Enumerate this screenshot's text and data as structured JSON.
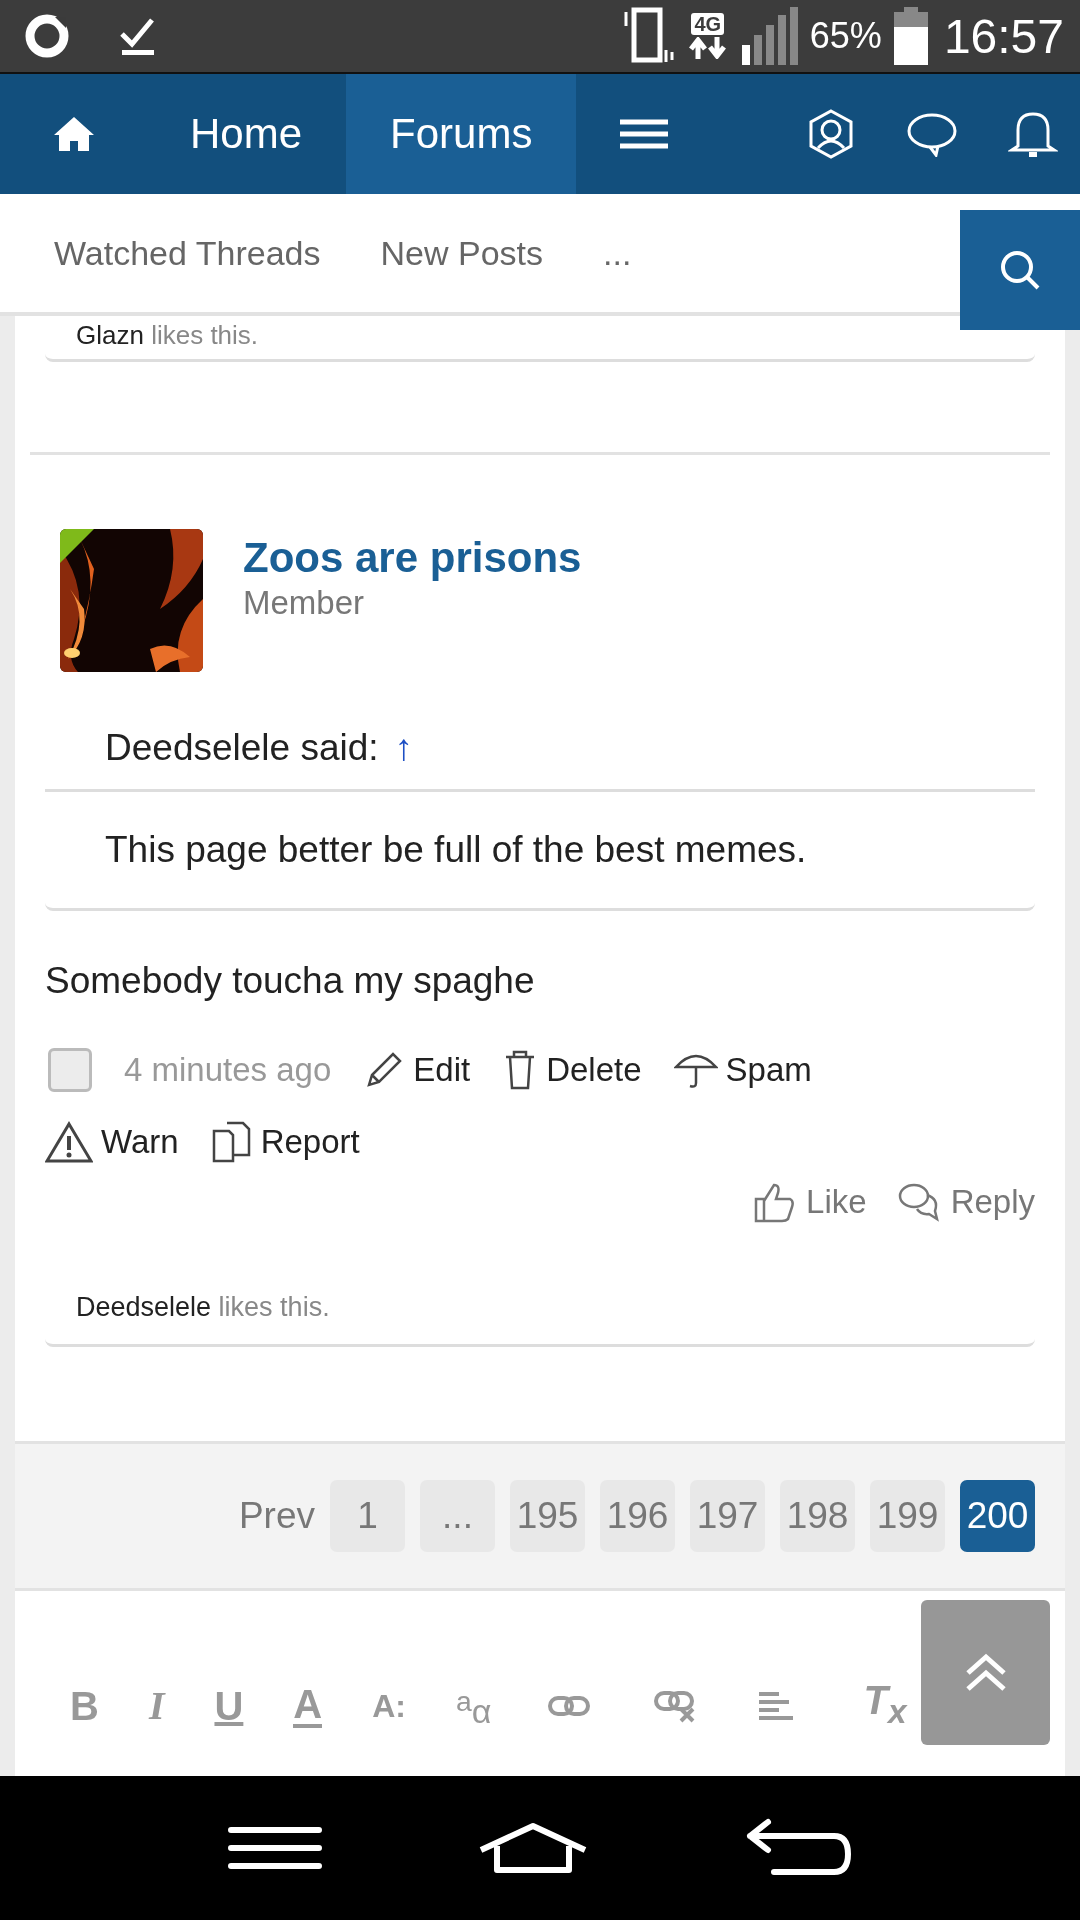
{
  "status_bar": {
    "network": "4G",
    "battery": "65%",
    "time": "16:57"
  },
  "nav": {
    "tabs": [
      {
        "label": "Home",
        "selected": false
      },
      {
        "label": "Forums",
        "selected": true
      }
    ]
  },
  "subnav": {
    "links": [
      "Watched Threads",
      "New Posts",
      "..."
    ]
  },
  "previous_post": {
    "liker": "Glazn",
    "likes_text": "likes this."
  },
  "post": {
    "author": "Zoos are prisons",
    "role": "Member",
    "online": true,
    "quote": {
      "author_line": "Deedselele said:",
      "jump": "↑",
      "text": "This page better be full of the best memes."
    },
    "message": "Somebody toucha my spaghe",
    "checked": false,
    "time": "4 minutes ago",
    "actions": [
      {
        "kind": "edit",
        "label": "Edit"
      },
      {
        "kind": "delete",
        "label": "Delete"
      },
      {
        "kind": "spam",
        "label": "Spam"
      },
      {
        "kind": "warn",
        "label": "Warn"
      },
      {
        "kind": "report",
        "label": "Report"
      }
    ],
    "footer_actions": [
      {
        "kind": "like",
        "label": "Like"
      },
      {
        "kind": "reply",
        "label": "Reply"
      }
    ],
    "likes": {
      "liker": "Deedselele",
      "text": "likes this."
    }
  },
  "pagination": {
    "prev": "Prev",
    "pages": [
      {
        "label": "1",
        "selected": false
      },
      {
        "label": "...",
        "selected": false
      },
      {
        "label": "195",
        "selected": false
      },
      {
        "label": "196",
        "selected": false
      },
      {
        "label": "197",
        "selected": false
      },
      {
        "label": "198",
        "selected": false
      },
      {
        "label": "199",
        "selected": false
      },
      {
        "label": "200",
        "selected": true
      }
    ]
  },
  "editor": {
    "tools": [
      {
        "kind": "glyph",
        "label": "B"
      },
      {
        "kind": "glyph",
        "label": "I"
      },
      {
        "kind": "glyph",
        "label": "U"
      },
      {
        "kind": "glyph",
        "label": "A"
      },
      {
        "kind": "glyph",
        "label": "A:"
      },
      {
        "kind": "glyph",
        "label": "$^{a}$α"
      },
      {
        "kind": "link"
      },
      {
        "kind": "unlink"
      },
      {
        "kind": "align"
      },
      {
        "kind": "glyph",
        "label": "T$_{x}$"
      }
    ]
  }
}
